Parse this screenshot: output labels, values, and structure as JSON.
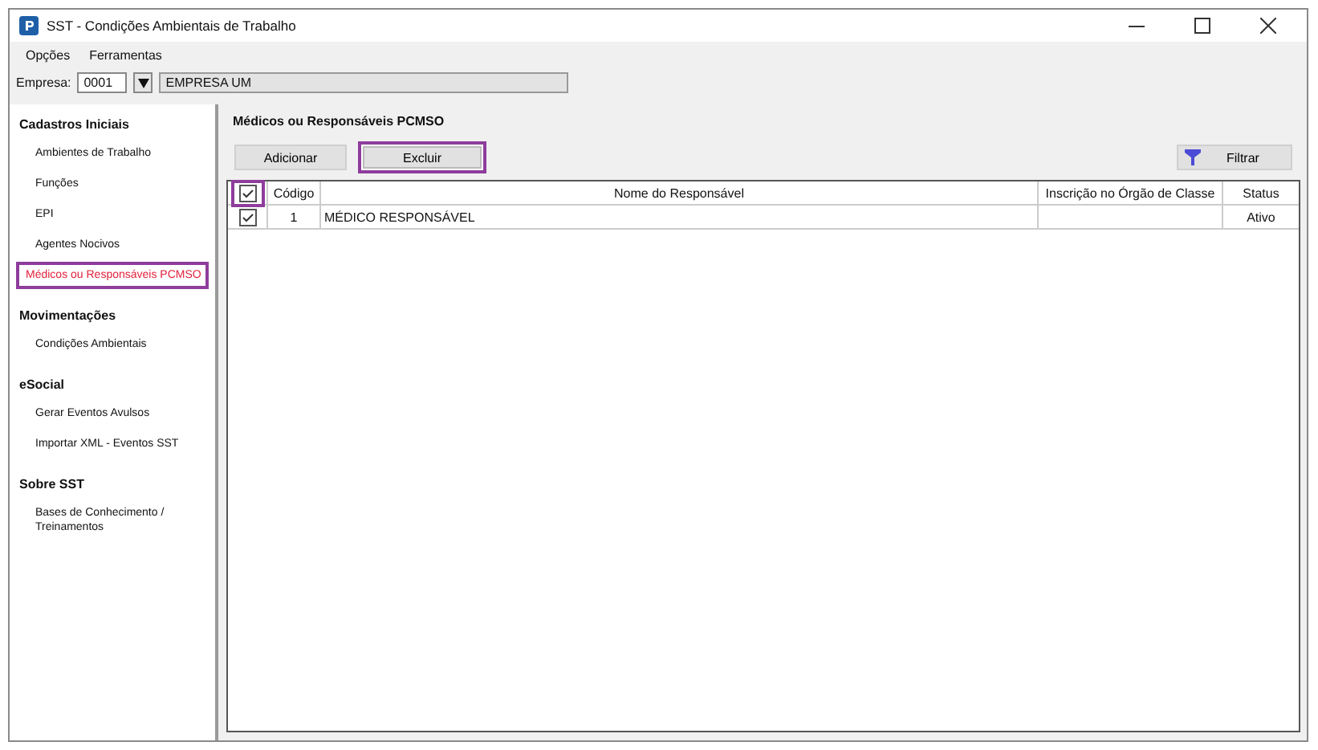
{
  "window": {
    "title": "SST - Condições Ambientais de Trabalho"
  },
  "menu": [
    "Opções",
    "Ferramentas"
  ],
  "empresa": {
    "label": "Empresa:",
    "code": "0001",
    "name": "EMPRESA UM"
  },
  "sidebar": [
    {
      "title": "Cadastros Iniciais",
      "items": [
        {
          "label": "Ambientes de Trabalho",
          "selected": false
        },
        {
          "label": "Funções",
          "selected": false
        },
        {
          "label": "EPI",
          "selected": false
        },
        {
          "label": "Agentes Nocivos",
          "selected": false
        },
        {
          "label": "Médicos ou Responsáveis PCMSO",
          "selected": true
        }
      ]
    },
    {
      "title": "Movimentações",
      "items": [
        {
          "label": "Condições Ambientais",
          "selected": false
        }
      ]
    },
    {
      "title": "eSocial",
      "items": [
        {
          "label": "Gerar Eventos Avulsos",
          "selected": false
        },
        {
          "label": "Importar XML - Eventos SST",
          "selected": false
        }
      ]
    },
    {
      "title": "Sobre SST",
      "items": [
        {
          "label": "Bases de Conhecimento / Treinamentos",
          "selected": false
        }
      ]
    }
  ],
  "panel_title": "Médicos ou Responsáveis PCMSO",
  "buttons": [
    {
      "label": "Adicionar",
      "highlighted": false
    },
    {
      "label": "Excluir",
      "highlighted": true
    }
  ],
  "filter_button": "Filtrar",
  "table": {
    "header_checked": true,
    "header_check_highlighted": true,
    "columns": [
      "Código",
      "Nome do Responsável",
      "Inscrição no Órgão de Classe",
      "Status"
    ],
    "rows": [
      {
        "checked": true,
        "cells": [
          "1",
          "MÉDICO RESPONSÁVEL",
          "",
          "Ativo"
        ]
      }
    ]
  }
}
